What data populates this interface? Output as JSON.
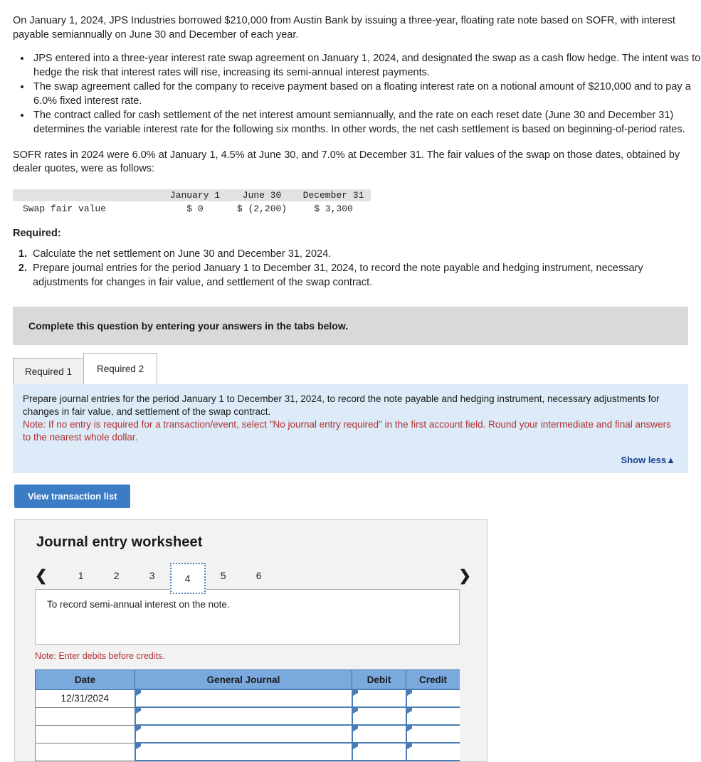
{
  "intro": {
    "paragraph1": "On January 1, 2024, JPS Industries borrowed $210,000 from Austin Bank by issuing a three-year, floating rate note based on SOFR, with interest payable semiannually on June 30 and December of each year.",
    "bullets": [
      "JPS entered into a three-year interest rate swap agreement on January 1, 2024, and designated the swap as a cash flow hedge. The intent was to hedge the risk that interest rates will rise, increasing its semi-annual interest payments.",
      "The swap agreement called for the company to receive payment based on a floating interest rate on a notional amount of $210,000 and to pay a 6.0% fixed interest rate.",
      "The contract called for cash settlement of the net interest amount semiannually, and the rate on each reset date (June 30 and December 31) determines the variable interest rate for the following six months. In other words, the net cash settlement is based on beginning-of-period rates."
    ],
    "paragraph2": "SOFR rates in 2024 were 6.0% at January 1, 4.5% at June 30, and 7.0% at December 31. The fair values of the swap on those dates, obtained by dealer quotes, were as follows:"
  },
  "fair_value_table": {
    "columns": [
      "",
      "January 1",
      "June 30",
      "December 31"
    ],
    "rows": [
      {
        "label": "Swap fair value",
        "january_1": "$ 0",
        "june_30": "$ (2,200)",
        "december_31": "$ 3,300"
      }
    ]
  },
  "required": {
    "heading": "Required:",
    "items": [
      "Calculate the net settlement on June 30 and December 31, 2024.",
      "Prepare journal entries for the period January 1 to December 31, 2024, to record the note payable and hedging instrument, necessary adjustments for changes in fair value, and settlement of the swap contract."
    ]
  },
  "complete_bar": {
    "text": "Complete this question by entering your answers in the tabs below."
  },
  "tabs": [
    {
      "label": "Required 1",
      "active": false
    },
    {
      "label": "Required 2",
      "active": true
    }
  ],
  "info_panel": {
    "instruction": "Prepare journal entries for the period January 1 to December 31, 2024, to record the note payable and hedging instrument, necessary adjustments for changes in fair value, and settlement of the swap contract.",
    "note": "Note: If no entry is required for a transaction/event, select \"No journal entry required\" in the first account field. Round your intermediate and final answers to the nearest whole dollar.",
    "show_less_label": "Show less▲",
    "background_color": "#dcebf7"
  },
  "buttons": {
    "view_transaction_list": "View transaction list"
  },
  "worksheet": {
    "title": "Journal entry worksheet",
    "pager": {
      "prev_icon": "chevron-left",
      "next_icon": "chevron-right",
      "pages": [
        "1",
        "2",
        "3",
        "4",
        "5",
        "6"
      ],
      "selected": "4"
    },
    "description": "To record semi-annual interest on the note.",
    "debits_note": "Note: Enter debits before credits.",
    "table": {
      "headers": [
        "Date",
        "General Journal",
        "Debit",
        "Credit"
      ],
      "rows": [
        {
          "date": "12/31/2024",
          "general_journal": "",
          "debit": "",
          "credit": ""
        },
        {
          "date": "",
          "general_journal": "",
          "debit": "",
          "credit": ""
        },
        {
          "date": "",
          "general_journal": "",
          "debit": "",
          "credit": ""
        },
        {
          "date": "",
          "general_journal": "",
          "debit": "",
          "credit": ""
        }
      ]
    }
  },
  "colors": {
    "accent_blue": "#3c7cc4",
    "table_header_blue": "#7aa9de",
    "info_blue": "#dcebf7",
    "grey_bar": "#d9d9d9",
    "note_red": "#b03030"
  }
}
